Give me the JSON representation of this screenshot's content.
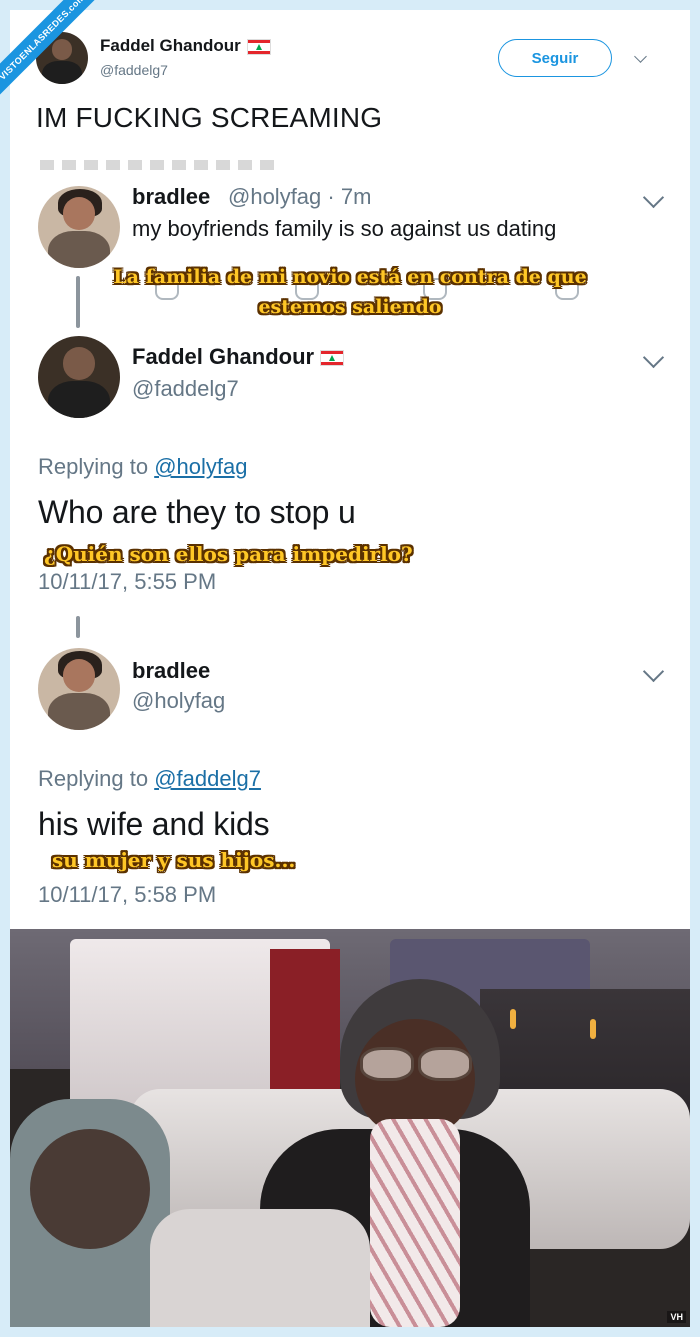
{
  "watermark": "VISTOENLASREDES.com",
  "header": {
    "name": "Faddel Ghandour",
    "handle": "@faddelg7",
    "follow_label": "Seguir",
    "tweet_text": "IM FUCKING SCREAMING"
  },
  "thread": [
    {
      "name": "bradlee",
      "handle": "@holyfag",
      "time": "· 7m",
      "text": "my boyfriends family is so against us dating",
      "caption_line1": "La familia de mi novio está en contra de que",
      "caption_line2": "estemos saliendo"
    },
    {
      "name": "Faddel Ghandour",
      "handle": "@faddelg7",
      "replying_prefix": "Replying to",
      "replying_to": "@holyfag",
      "text": "Who are they to stop u",
      "caption": "¿Quién son ellos para impedirlo?",
      "timestamp": "10/11/17, 5:55 PM"
    },
    {
      "name": "bradlee",
      "handle": "@holyfag",
      "replying_prefix": "Replying to",
      "replying_to": "@faddelg7",
      "text": "his wife and kids",
      "caption": "su mujer y sus hijos...",
      "timestamp": "10/11/17, 5:58 PM"
    }
  ],
  "photo": {
    "badge": "VH"
  },
  "colors": {
    "background": "#d7ecf8",
    "accent": "#1b95e0",
    "caption_fill": "#ffc726",
    "caption_outline": "#5b3100"
  }
}
